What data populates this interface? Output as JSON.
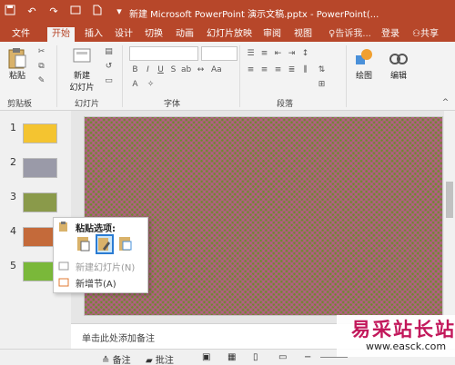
{
  "window": {
    "title": "新建 Microsoft PowerPoint 演示文稿.pptx - PowerPoint(..."
  },
  "quick_access": {
    "icons": [
      "save-icon",
      "undo-icon",
      "redo-icon",
      "start-from-beginning-icon",
      "new-icon"
    ]
  },
  "tabs": [
    {
      "label": "文件"
    },
    {
      "label": "开始",
      "active": true
    },
    {
      "label": "插入"
    },
    {
      "label": "设计"
    },
    {
      "label": "切换"
    },
    {
      "label": "动画"
    },
    {
      "label": "幻灯片放映"
    },
    {
      "label": "审阅"
    },
    {
      "label": "视图"
    }
  ],
  "tell_me": "♀告诉我...",
  "account": {
    "signin": "登录",
    "share": "共享"
  },
  "ribbon": {
    "groups": {
      "clipboard": "剪贴板",
      "slides": "幻灯片",
      "font": "字体",
      "paragraph": "段落"
    },
    "paste_label": "粘贴",
    "new_slide_label_1": "新建",
    "new_slide_label_2": "幻灯片",
    "draw_label": "绘图",
    "edit_label": "编辑"
  },
  "thumbnails": [
    {
      "num": "1",
      "color": "#f4c430"
    },
    {
      "num": "2",
      "color": "#9a9aa8"
    },
    {
      "num": "3",
      "color": "#8a9a4a"
    },
    {
      "num": "4",
      "color": "#c46a3a"
    },
    {
      "num": "5",
      "color": "#7ab83a"
    }
  ],
  "context_menu": {
    "header": "粘贴选项:",
    "items": [
      {
        "label": "新建幻灯片(N)",
        "disabled": true
      },
      {
        "label": "新增节(A)",
        "disabled": false
      }
    ]
  },
  "notes_placeholder": "单击此处添加备注",
  "status_bar": {
    "notes": "备注",
    "comments": "批注",
    "minus": "−",
    "plus": "+"
  },
  "watermark": {
    "line1": "易采站长站",
    "line2": "www.easck.com"
  }
}
